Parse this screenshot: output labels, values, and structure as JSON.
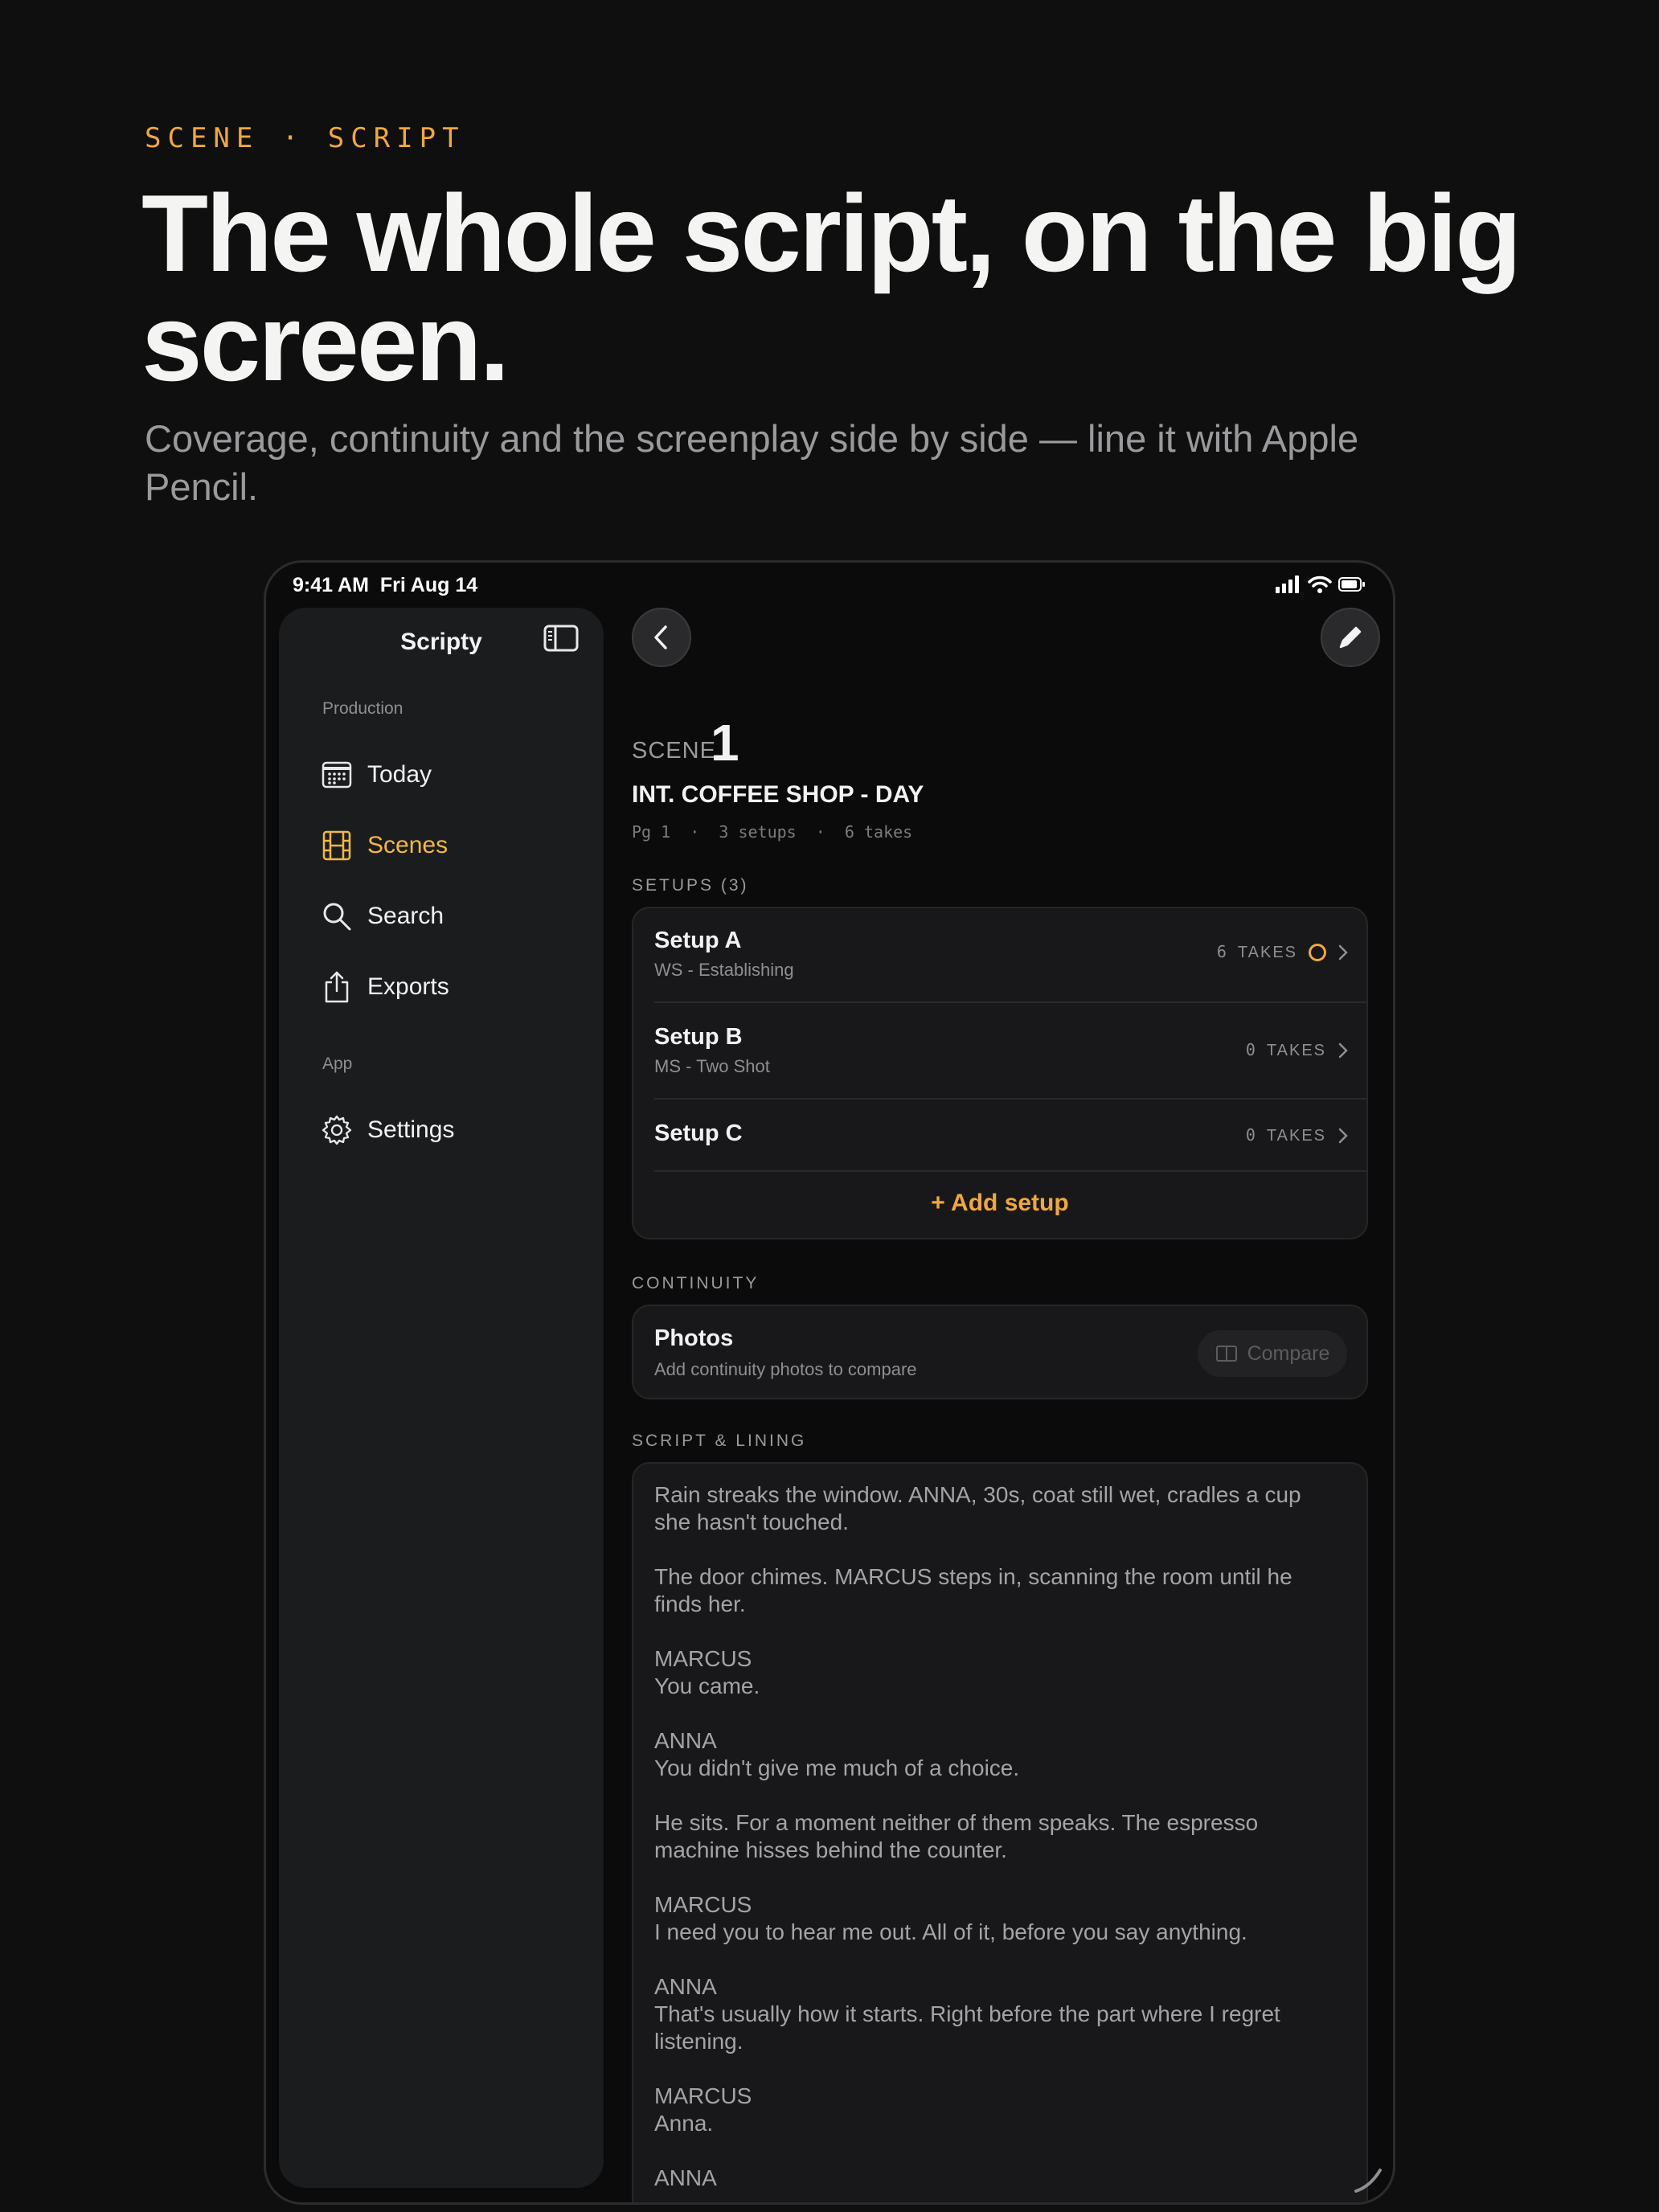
{
  "hero": {
    "eyebrow": "SCENE · SCRIPT",
    "headline": "The whole script, on the big screen.",
    "subhead": "Coverage, continuity and the screenplay side by side — line it with Apple Pencil."
  },
  "status_bar": {
    "time_date": "9:41 AM  Fri Aug 14"
  },
  "sidebar": {
    "title": "Scripty",
    "sections": [
      {
        "label": "Production"
      },
      {
        "label": "App"
      }
    ],
    "items": [
      {
        "label": "Today",
        "icon": "calendar-icon",
        "active": false
      },
      {
        "label": "Scenes",
        "icon": "film-icon",
        "active": true
      },
      {
        "label": "Search",
        "icon": "search-icon",
        "active": false
      },
      {
        "label": "Exports",
        "icon": "share-icon",
        "active": false
      },
      {
        "label": "Settings",
        "icon": "gear-icon",
        "active": false
      }
    ]
  },
  "scene": {
    "label": "SCENE",
    "number": "1",
    "heading": "INT. COFFEE SHOP - DAY",
    "meta": "Pg 1  ·  3 setups  ·  6 takes"
  },
  "setups": {
    "section_label": "SETUPS (3)",
    "items": [
      {
        "name": "Setup A",
        "subtitle": "WS - Establishing",
        "takes": "6",
        "takes_word": "TAKES"
      },
      {
        "name": "Setup B",
        "subtitle": "MS - Two Shot",
        "takes": "0",
        "takes_word": "TAKES"
      },
      {
        "name": "Setup C",
        "subtitle": "",
        "takes": "0",
        "takes_word": "TAKES"
      }
    ],
    "add_label": "+ Add setup"
  },
  "continuity": {
    "section_label": "CONTINUITY",
    "title": "Photos",
    "subtitle": "Add continuity photos to compare",
    "compare_label": "Compare"
  },
  "script": {
    "section_label": "SCRIPT & LINING",
    "paragraphs": [
      "Rain streaks the window. ANNA, 30s, coat still wet, cradles a cup she hasn't touched.",
      "The door chimes. MARCUS steps in, scanning the room until he finds her.",
      "MARCUS\nYou came.",
      "ANNA\nYou didn't give me much of a choice.",
      "He sits. For a moment neither of them speaks. The espresso machine hisses behind the counter.",
      "MARCUS\nI need you to hear me out. All of it, before you say anything.",
      "ANNA\nThat's usually how it starts. Right before the part where I regret listening.",
      "MARCUS\nAnna.",
      "ANNA"
    ]
  },
  "colors": {
    "accent": "#f0a83a",
    "active_nav": "#f2b93d",
    "background": "#0f0f10",
    "card": "#18181a"
  }
}
